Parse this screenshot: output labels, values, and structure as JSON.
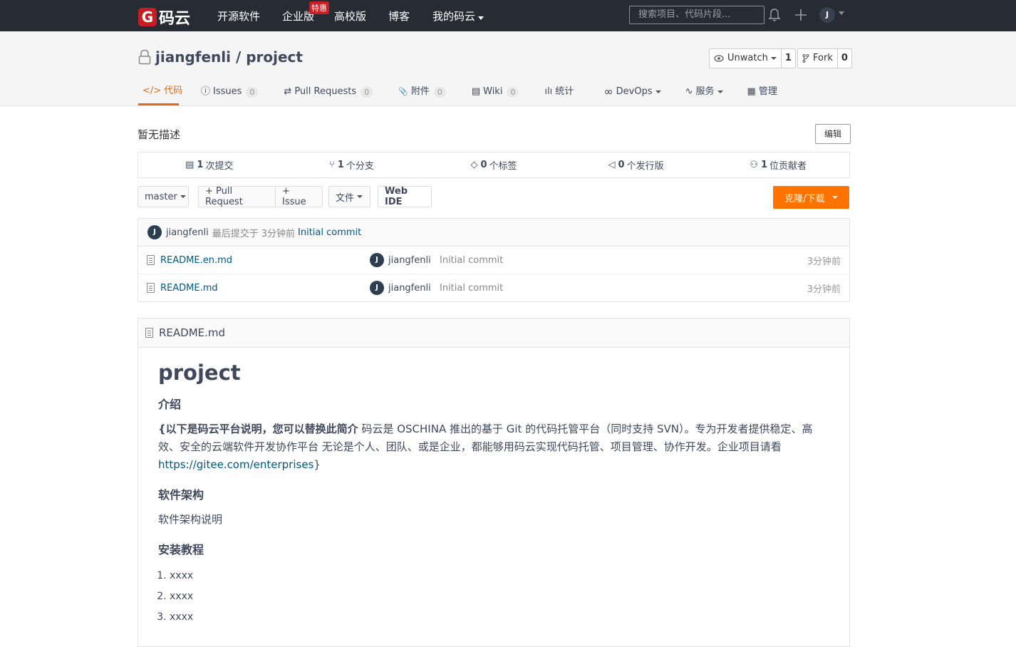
{
  "topnav": {
    "logo_text": "码云",
    "logo_glyph": "G",
    "items": [
      "开源软件",
      "企业版",
      "高校版",
      "博客",
      "我的码云"
    ],
    "badge": "特惠",
    "search_placeholder": "搜索项目、代码片段...",
    "avatar_letter": "J"
  },
  "project": {
    "title": "jiangfenli / project",
    "watch_label": "Unwatch",
    "watch_count": "1",
    "fork_label": "Fork",
    "fork_count": "0"
  },
  "tabs": [
    {
      "label": "代码",
      "icon": "</>"
    },
    {
      "label": "Issues",
      "count": "0",
      "icon": "ⓘ"
    },
    {
      "label": "Pull Requests",
      "count": "0",
      "icon": "⇄"
    },
    {
      "label": "附件",
      "count": "0",
      "icon": "📎"
    },
    {
      "label": "Wiki",
      "count": "0",
      "icon": "▤"
    },
    {
      "label": "统计",
      "icon": "ılı"
    },
    {
      "label": "DevOps",
      "icon": "∞"
    },
    {
      "label": "服务",
      "icon": "∿"
    },
    {
      "label": "管理",
      "icon": "▦"
    }
  ],
  "description": "暂无描述",
  "edit_label": "编辑",
  "stats": [
    {
      "num": "1",
      "label": "次提交"
    },
    {
      "num": "1",
      "label": "个分支"
    },
    {
      "num": "0",
      "label": "个标签"
    },
    {
      "num": "0",
      "label": "个发行版"
    },
    {
      "num": "1",
      "label": "位贡献者"
    }
  ],
  "toolbar": {
    "branch": "master",
    "pull_request": "+ Pull Request",
    "issue": "+ Issue",
    "file": "文件",
    "webide": "Web IDE",
    "clone": "克隆/下载"
  },
  "last_commit": {
    "avatar": "J",
    "author": "jiangfenli",
    "text": "最后提交于",
    "time": "3分钟前",
    "message": "Initial commit"
  },
  "files": [
    {
      "name": "README.en.md",
      "avatar": "J",
      "author": "jiangfenli",
      "message": "Initial commit",
      "time": "3分钟前"
    },
    {
      "name": "README.md",
      "avatar": "J",
      "author": "jiangfenli",
      "message": "Initial commit",
      "time": "3分钟前"
    }
  ],
  "readme": {
    "filename": "README.md",
    "h1": "project",
    "h_intro": "介绍",
    "intro_bold": "{以下是码云平台说明，您可以替换此简介",
    "intro_text": " 码云是 OSCHINA 推出的基于 Git 的代码托管平台（同时支持 SVN）。专为开发者提供稳定、高效、安全的云端软件开发协作平台 无论是个人、团队、或是企业，都能够用码云实现代码托管、项目管理、协作开发。企业项目请看 ",
    "intro_link": "https://gitee.com/enterprises",
    "intro_end": "}",
    "h_arch": "软件架构",
    "arch_text": "软件架构说明",
    "h_install": "安装教程",
    "install_items": [
      "xxxx",
      "xxxx",
      "xxxx"
    ]
  }
}
